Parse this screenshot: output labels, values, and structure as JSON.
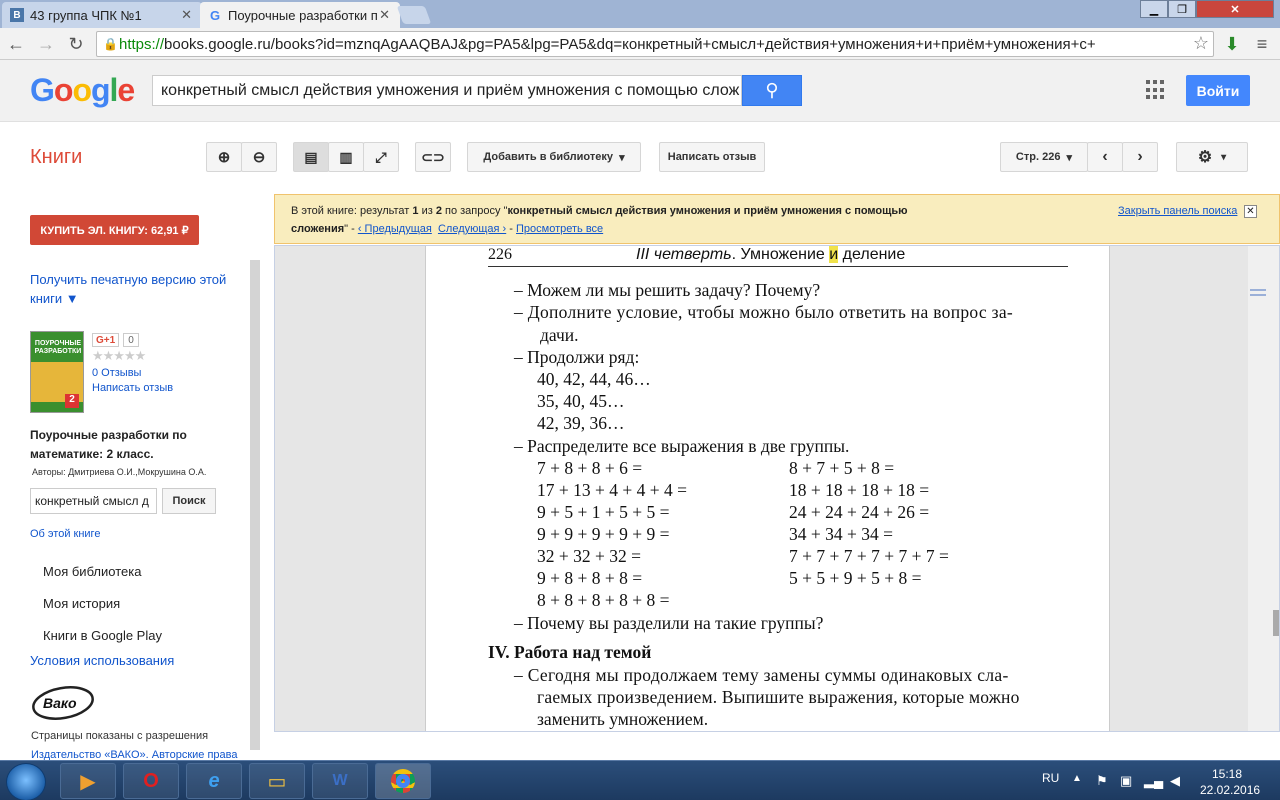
{
  "browser": {
    "tabs": [
      {
        "label": "43 группа ЧПК №1",
        "icon": "vk-icon"
      },
      {
        "label": "Поурочные разработки п",
        "icon": "google-icon"
      }
    ],
    "url_scheme": "https://",
    "url_rest": "books.google.ru/books?id=mznqAgAAQBAJ&pg=PA5&lpg=PA5&dq=конкретный+смысл+действия+умножения+и+приём+умножения+с+"
  },
  "google": {
    "logo": "Google",
    "search_value": "конкретный смысл действия умножения и приём умножения с помощью слож",
    "login": "Войти"
  },
  "books_toolbar": {
    "section": "Книги",
    "add_library": "Добавить в библиотеку",
    "write_review": "Написать отзыв",
    "page_select": "Стр. 226"
  },
  "sidebar": {
    "buy": "КУПИТЬ ЭЛ. КНИГУ: 62,91 ₽",
    "print_version": "Получить печатную версию этой книги ▼",
    "gplus": "G+1",
    "gplus_count": "0",
    "reviews_count": "0 Отзывы",
    "write_review": "Написать отзыв",
    "book_title": "Поурочные разработки по математике: 2 класс.",
    "authors": "Авторы: Дмитриева О.И.,Мокрушина О.А.",
    "search_value": "конкретный смысл д",
    "search_button": "Поиск",
    "about": "Об этой книге",
    "menu": [
      "Моя библиотека",
      "Моя история",
      "Книги в Google Play"
    ],
    "terms": "Условия использования",
    "publisher_logo": "Вако",
    "pages_shown": "Страницы показаны с разрешения",
    "publisher_line": "Издательство «ВАКО». Авторские права",
    "cover_title": "ПОУРОЧНЫЕ РАЗРАБОТКИ",
    "cover_grade": "2"
  },
  "search_panel": {
    "prefix": "В этой книге: результат ",
    "n1": "1",
    "of": " из ",
    "n2": "2",
    "query_prefix": " по запросу \"",
    "query_1": "конкретный смысл действия умножения и приём умножения с помощью",
    "query_2": "сложения",
    "query_suffix": "\"  -  ",
    "prev": "‹ Предыдущая",
    "next": "Следующая ›",
    "dash": "  -  ",
    "view_all": "Просмотреть все",
    "close": "Закрыть панель поиска"
  },
  "page": {
    "number": "226",
    "header_pre": "III четверть",
    "header_post": ". Умножение ",
    "header_hl": "и",
    "header_end": " деление",
    "lines": [
      "–  Можем ли мы решить задачу? Почему?",
      "–  Дополните условие, чтобы можно было ответить на вопрос за-",
      "дачи.",
      "–  Продолжи ряд:",
      "40, 42, 44, 46…",
      "35, 40, 45…",
      "42, 39, 36…",
      "–  Распределите все выражения в две группы."
    ],
    "col1": [
      "7 + 8 + 8 + 6 =",
      "17 + 13 + 4 + 4 + 4 =",
      "9 + 5 + 1 + 5 + 5 =",
      "9 + 9 + 9 + 9 + 9 =",
      "32 + 32 + 32 =",
      "9 + 8 + 8 + 8 =",
      "8 + 8 + 8 + 8 + 8 ="
    ],
    "col2": [
      "8 + 7 + 5 + 8 =",
      "18 + 18 + 18 + 18 =",
      "24 + 24 + 24 + 26 =",
      "34 + 34 + 34 =",
      "7 + 7 + 7 + 7 + 7 + 7 =",
      "5 + 5 + 9 + 5 + 8 ="
    ],
    "why": "–  Почему вы разделили на такие группы?",
    "section": "IV. Работа над темой",
    "para": [
      "–  Сегодня мы продолжаем тему замены суммы одинаковых сла-",
      "гаемых произведением. Выпишите выражения, которые можно",
      "заменить умножением."
    ]
  },
  "taskbar": {
    "lang": "RU",
    "time": "15:18",
    "date": "22.02.2016"
  },
  "colors": {
    "buy": "#d14836",
    "google_blue": "#4285f4",
    "panel": "#f9edbe",
    "books_red": "#dd4b39"
  }
}
